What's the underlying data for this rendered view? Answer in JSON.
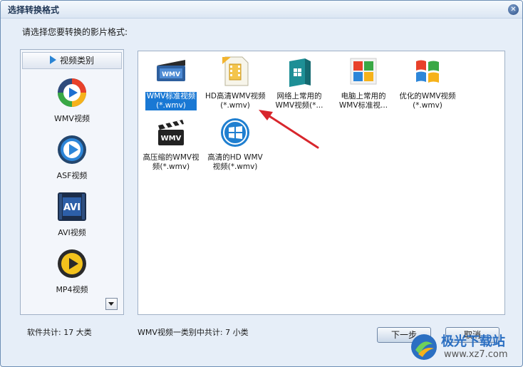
{
  "window": {
    "title": "选择转换格式"
  },
  "prompt": "请选择您要转换的影片格式:",
  "sidebar": {
    "header": "视频类别",
    "categories": [
      {
        "label": "WMV视频",
        "icon": "wmv-player-icon"
      },
      {
        "label": "ASF视频",
        "icon": "asf-play-icon"
      },
      {
        "label": "AVI视频",
        "icon": "avi-icon"
      },
      {
        "label": "MP4视频",
        "icon": "mp4-play-icon"
      }
    ]
  },
  "formats": [
    {
      "line1": "WMV标准视频",
      "line2": "(*.wmv)",
      "icon": "wmv-standard-icon",
      "selected": true
    },
    {
      "line1": "HD高清WMV视频",
      "line2": "(*.wmv)",
      "icon": "hd-film-icon"
    },
    {
      "line1": "网络上常用的",
      "line2": "WMV视频(*...",
      "icon": "windows-box-icon"
    },
    {
      "line1": "电脑上常用的",
      "line2": "WMV标准视...",
      "icon": "windows-flag-icon"
    },
    {
      "line1": "优化的WMV视频",
      "line2": "(*.wmv)",
      "icon": "windows-xp-logo-icon"
    },
    {
      "line1": "高压缩的WMV视",
      "line2": "频(*.wmv)",
      "icon": "wmv-clapper-icon"
    },
    {
      "line1": "高清的HD WMV",
      "line2": "视频(*.wmv)",
      "icon": "windows-circle-icon"
    }
  ],
  "status": {
    "software_total": "软件共计: 17  大类",
    "category_total": "WMV视频一类别中共计:  7   小类"
  },
  "buttons": {
    "next": "下一步",
    "cancel": "取消"
  },
  "watermark": {
    "name": "极光下载站",
    "url": "www.xz7.com"
  },
  "colors": {
    "selection": "#1978d4",
    "arrow": "#d8262c",
    "accent": "#2a84d4"
  }
}
